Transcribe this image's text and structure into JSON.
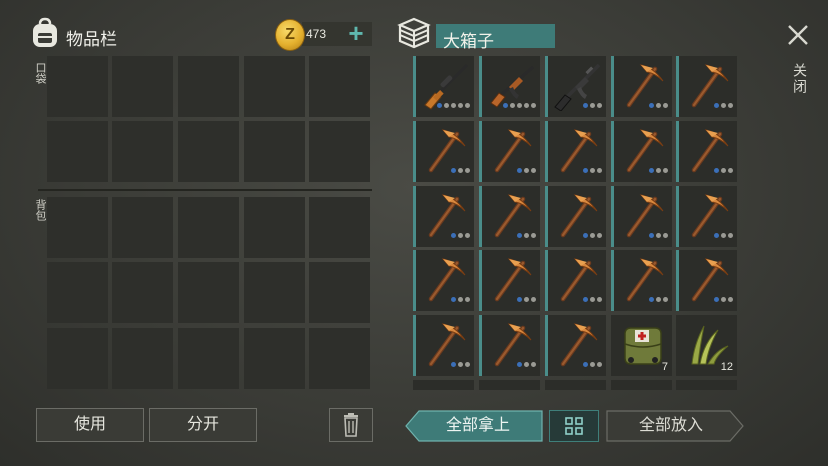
{
  "inventory": {
    "title": "物品栏",
    "pocket_label": "口袋",
    "backpack_label": "背包"
  },
  "currency": {
    "coin_symbol": "Z",
    "amount": "473",
    "add_label": "+"
  },
  "chest": {
    "title": "大箱子",
    "slots": [
      {
        "item": "sniper-rifle",
        "dots": 5,
        "qty": ""
      },
      {
        "item": "ak-rifle",
        "dots": 5,
        "qty": ""
      },
      {
        "item": "assault-rifle",
        "dots": 3,
        "qty": ""
      },
      {
        "item": "pickaxe",
        "dots": 3,
        "qty": ""
      },
      {
        "item": "pickaxe",
        "dots": 3,
        "qty": ""
      },
      {
        "item": "pickaxe",
        "dots": 3,
        "qty": ""
      },
      {
        "item": "pickaxe",
        "dots": 3,
        "qty": ""
      },
      {
        "item": "pickaxe",
        "dots": 3,
        "qty": ""
      },
      {
        "item": "pickaxe",
        "dots": 3,
        "qty": ""
      },
      {
        "item": "pickaxe",
        "dots": 3,
        "qty": ""
      },
      {
        "item": "pickaxe",
        "dots": 3,
        "qty": ""
      },
      {
        "item": "pickaxe",
        "dots": 3,
        "qty": ""
      },
      {
        "item": "pickaxe",
        "dots": 3,
        "qty": ""
      },
      {
        "item": "pickaxe",
        "dots": 3,
        "qty": ""
      },
      {
        "item": "pickaxe",
        "dots": 3,
        "qty": ""
      },
      {
        "item": "pickaxe",
        "dots": 3,
        "qty": ""
      },
      {
        "item": "pickaxe",
        "dots": 3,
        "qty": ""
      },
      {
        "item": "pickaxe",
        "dots": 3,
        "qty": ""
      },
      {
        "item": "pickaxe",
        "dots": 3,
        "qty": ""
      },
      {
        "item": "pickaxe",
        "dots": 3,
        "qty": ""
      },
      {
        "item": "pickaxe",
        "dots": 3,
        "qty": ""
      },
      {
        "item": "pickaxe",
        "dots": 3,
        "qty": ""
      },
      {
        "item": "pickaxe",
        "dots": 3,
        "qty": ""
      },
      {
        "item": "medkit-bag",
        "dots": 0,
        "qty": "7"
      },
      {
        "item": "plant-fiber",
        "dots": 0,
        "qty": "12"
      }
    ]
  },
  "buttons": {
    "use": "使用",
    "split": "分开",
    "take_all": "全部拿上",
    "put_all": "全部放入",
    "close": "关闭"
  },
  "colors": {
    "accent_teal": "#3e7b78",
    "dot_blue": "#3b6fb8",
    "dot_gray": "#9a9a94"
  }
}
